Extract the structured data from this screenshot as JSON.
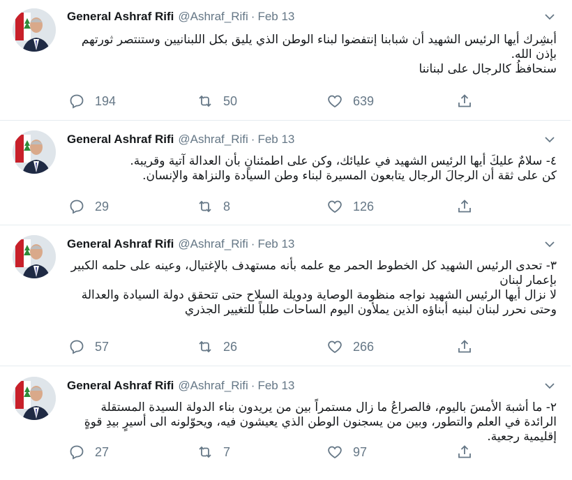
{
  "tweets": [
    {
      "name": "General Ashraf Rifi",
      "handle": "@Ashraf_Rifi",
      "dot": "·",
      "date": "Feb 13",
      "lines": [
        "أبشِرك أيها الرئيس الشهيد أن شبابنا إنتفضوا لبناء الوطن الذي يليق بكل اللبنانيين وستنتصر ثورتهم بإذن الله.",
        "سنحافظُ كالرجال على لبناننا"
      ],
      "replies": "194",
      "retweets": "50",
      "likes": "639"
    },
    {
      "name": "General Ashraf Rifi",
      "handle": "@Ashraf_Rifi",
      "dot": "·",
      "date": "Feb 13",
      "lines": [
        "٤- سلامٌ عليكَ أيها الرئيس الشهيد في عليائك، وكن على اطمئنانٍ بأن العدالة آتية وقريبة.",
        "كن على ثقة أن الرجالَ الرجال يتابعون المسيرة لبناء وطن السيادة والنزاهة والإنسان."
      ],
      "replies": "29",
      "retweets": "8",
      "likes": "126"
    },
    {
      "name": "General Ashraf Rifi",
      "handle": "@Ashraf_Rifi",
      "dot": "·",
      "date": "Feb 13",
      "lines": [
        "٣- تحدى الرئيس الشهيد كل الخطوط الحمر مع علمه بأنه مستهدف بالإغتيال، وعينه على حلمه الكبير بإعمار لبنان",
        "لا نزال أيها الرئيس الشهيد نواجه منظومة الوصاية ودويلة السلاح حتى تتحقق دولة السيادة والعدالة وحتى نحرر لبنان لبنيه أبناؤه الذين يملأون اليوم الساحات طلباً للتغيير الجذري"
      ],
      "replies": "57",
      "retweets": "26",
      "likes": "266"
    },
    {
      "name": "General Ashraf Rifi",
      "handle": "@Ashraf_Rifi",
      "dot": "·",
      "date": "Feb 13",
      "lines": [
        "٢- ما أشبهَ الأمسَ باليوم، فالصراعُ ما زال مستمراً بين من يريدون بناء الدولة السيدة المستقلة الرائدة في العلم والتطور، وبين من يسجنون الوطن الذي يعيشون فيه، ويحوّلونه الى أسيرٍ بيدِ قوةٍ إقليمية  رجعية."
      ],
      "replies": "27",
      "retweets": "7",
      "likes": "97"
    }
  ]
}
